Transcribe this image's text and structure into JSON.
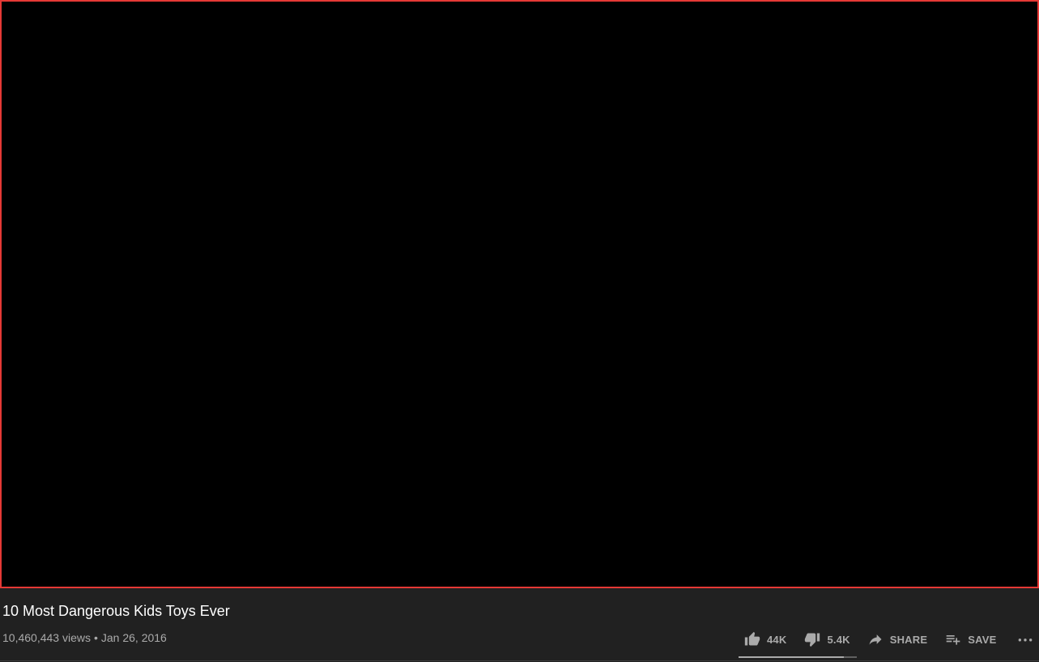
{
  "video": {
    "title": "10 Most Dangerous Kids Toys Ever",
    "views": "10,460,443 views",
    "separator": "•",
    "date": "Jan 26, 2016"
  },
  "actions": {
    "like_count": "44K",
    "dislike_count": "5.4K",
    "share_label": "SHARE",
    "save_label": "SAVE",
    "like_icon": "thumb-up-icon",
    "dislike_icon": "thumb-down-icon",
    "share_icon": "share-arrow-icon",
    "save_icon": "playlist-add-icon",
    "more_icon": "more-horizontal-icon"
  },
  "sentiment": {
    "like_ratio": 0.89
  },
  "colors": {
    "background": "#212121",
    "player": "#000000",
    "player_border": "#e53935",
    "title_text": "#ffffff",
    "secondary_text": "#aaaaaa"
  }
}
